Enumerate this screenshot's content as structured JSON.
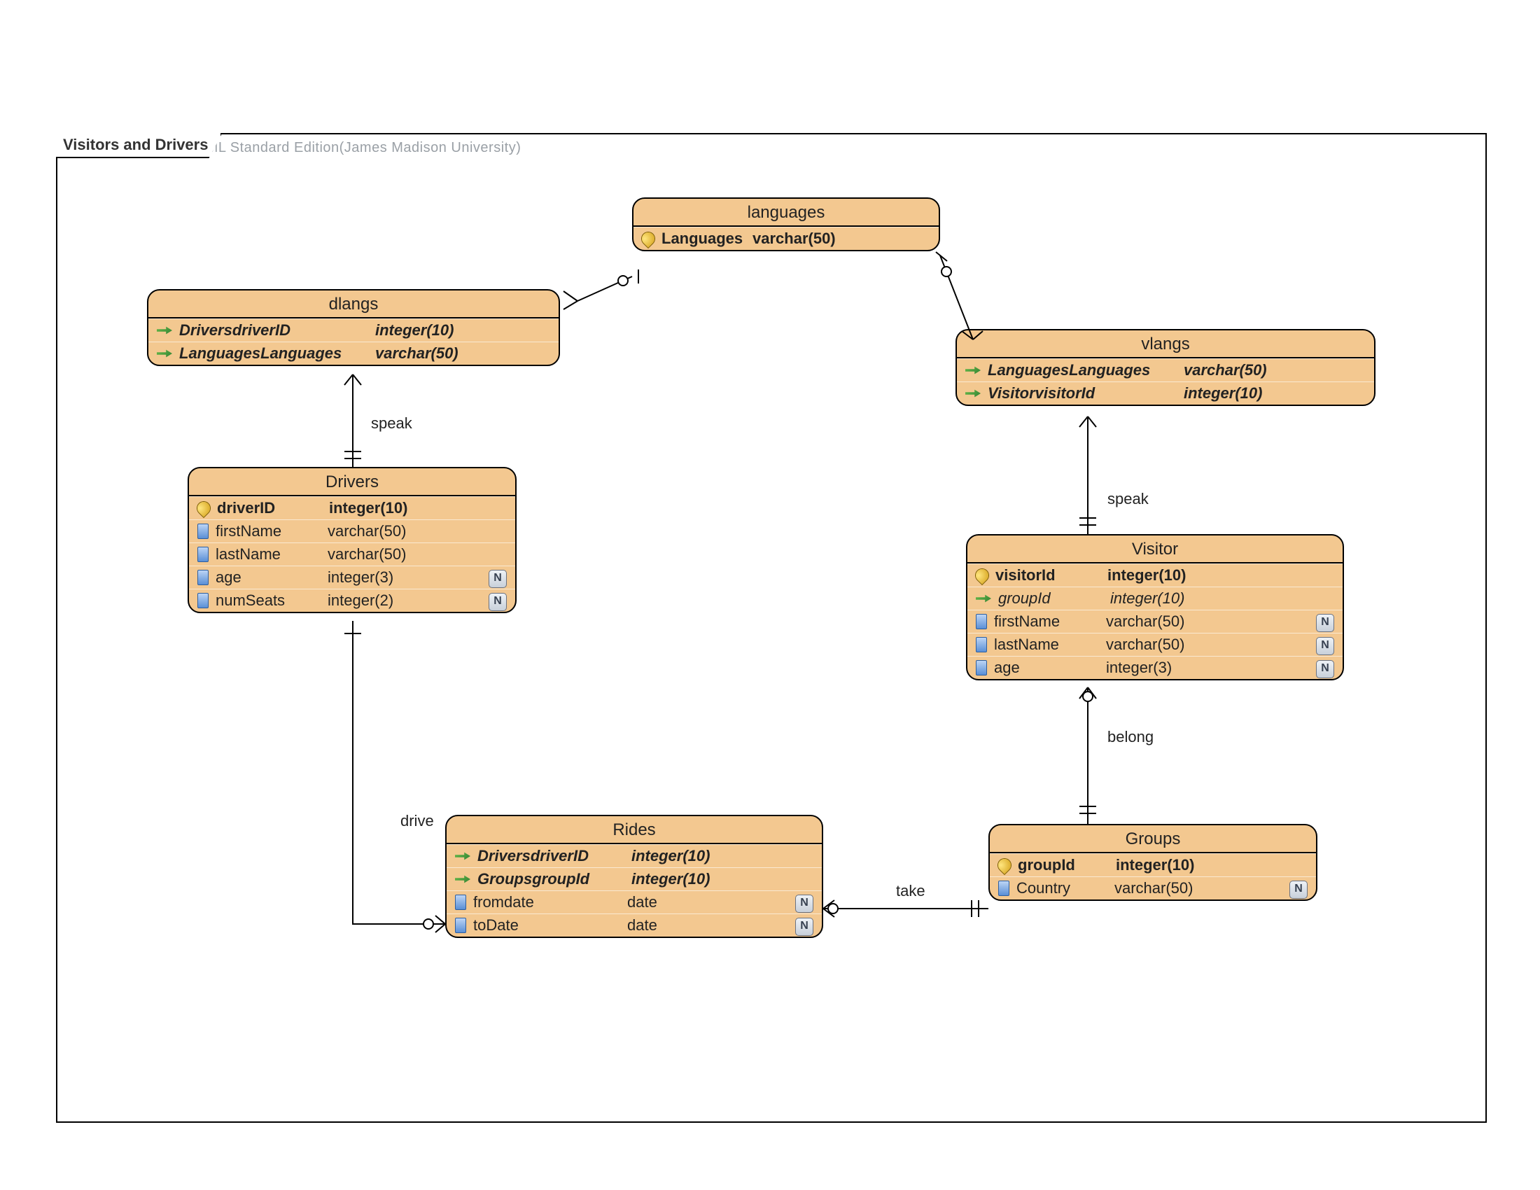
{
  "watermark": "Visual Paradigm for UML Standard Edition(James Madison University)",
  "frame_label": "Visitors and Drivers",
  "entities": {
    "languages": {
      "title": "languages",
      "attrs": [
        {
          "icon": "pk",
          "name": "Languages",
          "type": "varchar(50)",
          "bold": true
        }
      ]
    },
    "dlangs": {
      "title": "dlangs",
      "attrs": [
        {
          "icon": "fk",
          "name": "DriversdriverID",
          "type": "integer(10)",
          "bold": true,
          "italic": true
        },
        {
          "icon": "fk",
          "name": "LanguagesLanguages",
          "type": "varchar(50)",
          "bold": true,
          "italic": true
        }
      ]
    },
    "vlangs": {
      "title": "vlangs",
      "attrs": [
        {
          "icon": "fk",
          "name": "LanguagesLanguages",
          "type": "varchar(50)",
          "bold": true,
          "italic": true
        },
        {
          "icon": "fk",
          "name": "VisitorvisitorId",
          "type": "integer(10)",
          "bold": true,
          "italic": true
        }
      ]
    },
    "drivers": {
      "title": "Drivers",
      "attrs": [
        {
          "icon": "pk",
          "name": "driverID",
          "type": "integer(10)",
          "bold": true
        },
        {
          "icon": "col",
          "name": "firstName",
          "type": "varchar(50)"
        },
        {
          "icon": "col",
          "name": "lastName",
          "type": "varchar(50)"
        },
        {
          "icon": "col",
          "name": "age",
          "type": "integer(3)",
          "nullable": true
        },
        {
          "icon": "col",
          "name": "numSeats",
          "type": "integer(2)",
          "nullable": true
        }
      ]
    },
    "visitor": {
      "title": "Visitor",
      "attrs": [
        {
          "icon": "pk",
          "name": "visitorId",
          "type": "integer(10)",
          "bold": true
        },
        {
          "icon": "fk",
          "name": "groupId",
          "type": "integer(10)",
          "italic": true
        },
        {
          "icon": "col",
          "name": "firstName",
          "type": "varchar(50)",
          "nullable": true
        },
        {
          "icon": "col",
          "name": "lastName",
          "type": "varchar(50)",
          "nullable": true
        },
        {
          "icon": "col",
          "name": "age",
          "type": "integer(3)",
          "nullable": true
        }
      ]
    },
    "rides": {
      "title": "Rides",
      "attrs": [
        {
          "icon": "fk",
          "name": "DriversdriverID",
          "type": "integer(10)",
          "bold": true,
          "italic": true
        },
        {
          "icon": "fk",
          "name": "GroupsgroupId",
          "type": "integer(10)",
          "bold": true,
          "italic": true
        },
        {
          "icon": "col",
          "name": "fromdate",
          "type": "date",
          "nullable": true
        },
        {
          "icon": "col",
          "name": "toDate",
          "type": "date",
          "nullable": true
        }
      ]
    },
    "groups": {
      "title": "Groups",
      "attrs": [
        {
          "icon": "pk",
          "name": "groupId",
          "type": "integer(10)",
          "bold": true
        },
        {
          "icon": "col",
          "name": "Country",
          "type": "varchar(50)",
          "nullable": true
        }
      ]
    }
  },
  "relations": {
    "speak1": "speak",
    "speak2": "speak",
    "drive": "drive",
    "take": "take",
    "belong": "belong"
  }
}
